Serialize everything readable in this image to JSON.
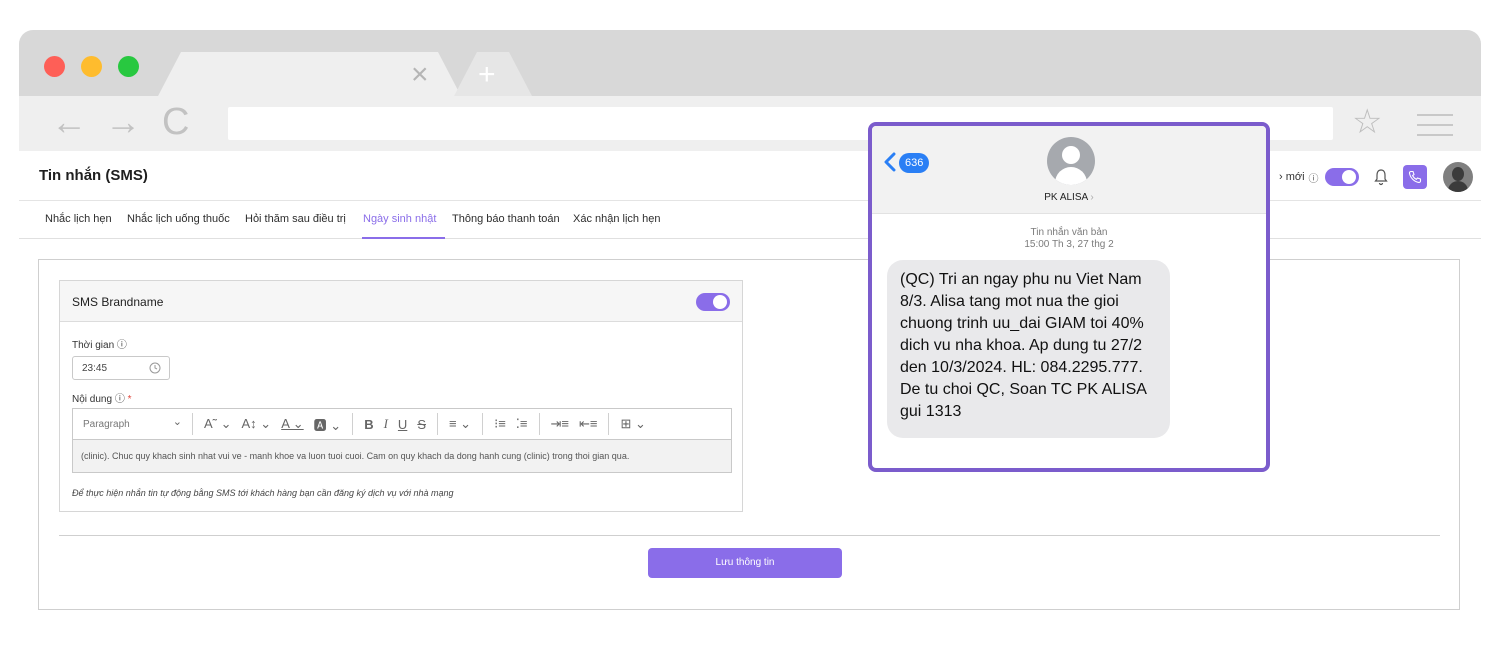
{
  "browser": {
    "tab_close": "×",
    "tab_new": "+",
    "nav_back": "←",
    "nav_forward": "→",
    "nav_reload": "C",
    "bookmark_star": "☆"
  },
  "app": {
    "title": "Tin nhắn (SMS)",
    "header_right_label": "› mới",
    "header_info_icon": "ⓘ"
  },
  "tabs": [
    {
      "label": "Nhắc lịch hẹn"
    },
    {
      "label": "Nhắc lịch uống thuốc"
    },
    {
      "label": "Hỏi thăm sau điều trị"
    },
    {
      "label": "Ngày sinh nhật"
    },
    {
      "label": "Thông báo thanh toán"
    },
    {
      "label": "Xác nhận lịch hẹn"
    }
  ],
  "card": {
    "title": "SMS Brandname",
    "time_label": "Thời gian",
    "time_value": "23:45",
    "content_label": "Nội dung",
    "required_mark": "*",
    "info_icon": "ⓘ",
    "editor_paragraph": "Paragraph",
    "editor_text": "(clinic). Chuc quy khach sinh nhat vui ve - manh khoe va luon tuoi cuoi. Cam on quy khach da dong hanh cung (clinic) trong thoi gian qua.",
    "note": "Để thực hiện nhắn tin tự động bằng SMS tới khách hàng bạn cần đăng ký dịch vụ với nhà mạng"
  },
  "toolbar": {
    "heading_font": "A˜ ⌄",
    "font_size": "A↕ ⌄",
    "font_color": "A ⌄",
    "bg_color": "🅰 ⌄",
    "bold": "B",
    "italic": "I",
    "underline": "U",
    "strike": "S",
    "align": "≡ ⌄",
    "ordered_list": "⁝≡",
    "bullet_list": "⁚≡",
    "indent": "⇥≡",
    "outdent": "⇤≡",
    "table": "⊞ ⌄"
  },
  "save_button": "Lưu thông tin",
  "sms": {
    "badge": "636",
    "contact": "PK ALISA",
    "contact_chevron": "›",
    "meta_type": "Tin nhắn văn bản",
    "meta_time": "15:00 Th 3, 27 thg 2",
    "message": "(QC) Tri an ngay phu nu Viet Nam 8/3. Alisa tang mot nua the gioi chuong trinh uu_dai GIAM toi 40% dich vu nha khoa. Ap dung tu 27/2 den 10/3/2024. HL: 084.2295.777. De tu choi QC, Soan TC PK ALISA gui 1313"
  },
  "colors": {
    "accent": "#8a6de9",
    "sms_frame": "#7b5ccc",
    "ios_blue": "#2a7ff5"
  }
}
